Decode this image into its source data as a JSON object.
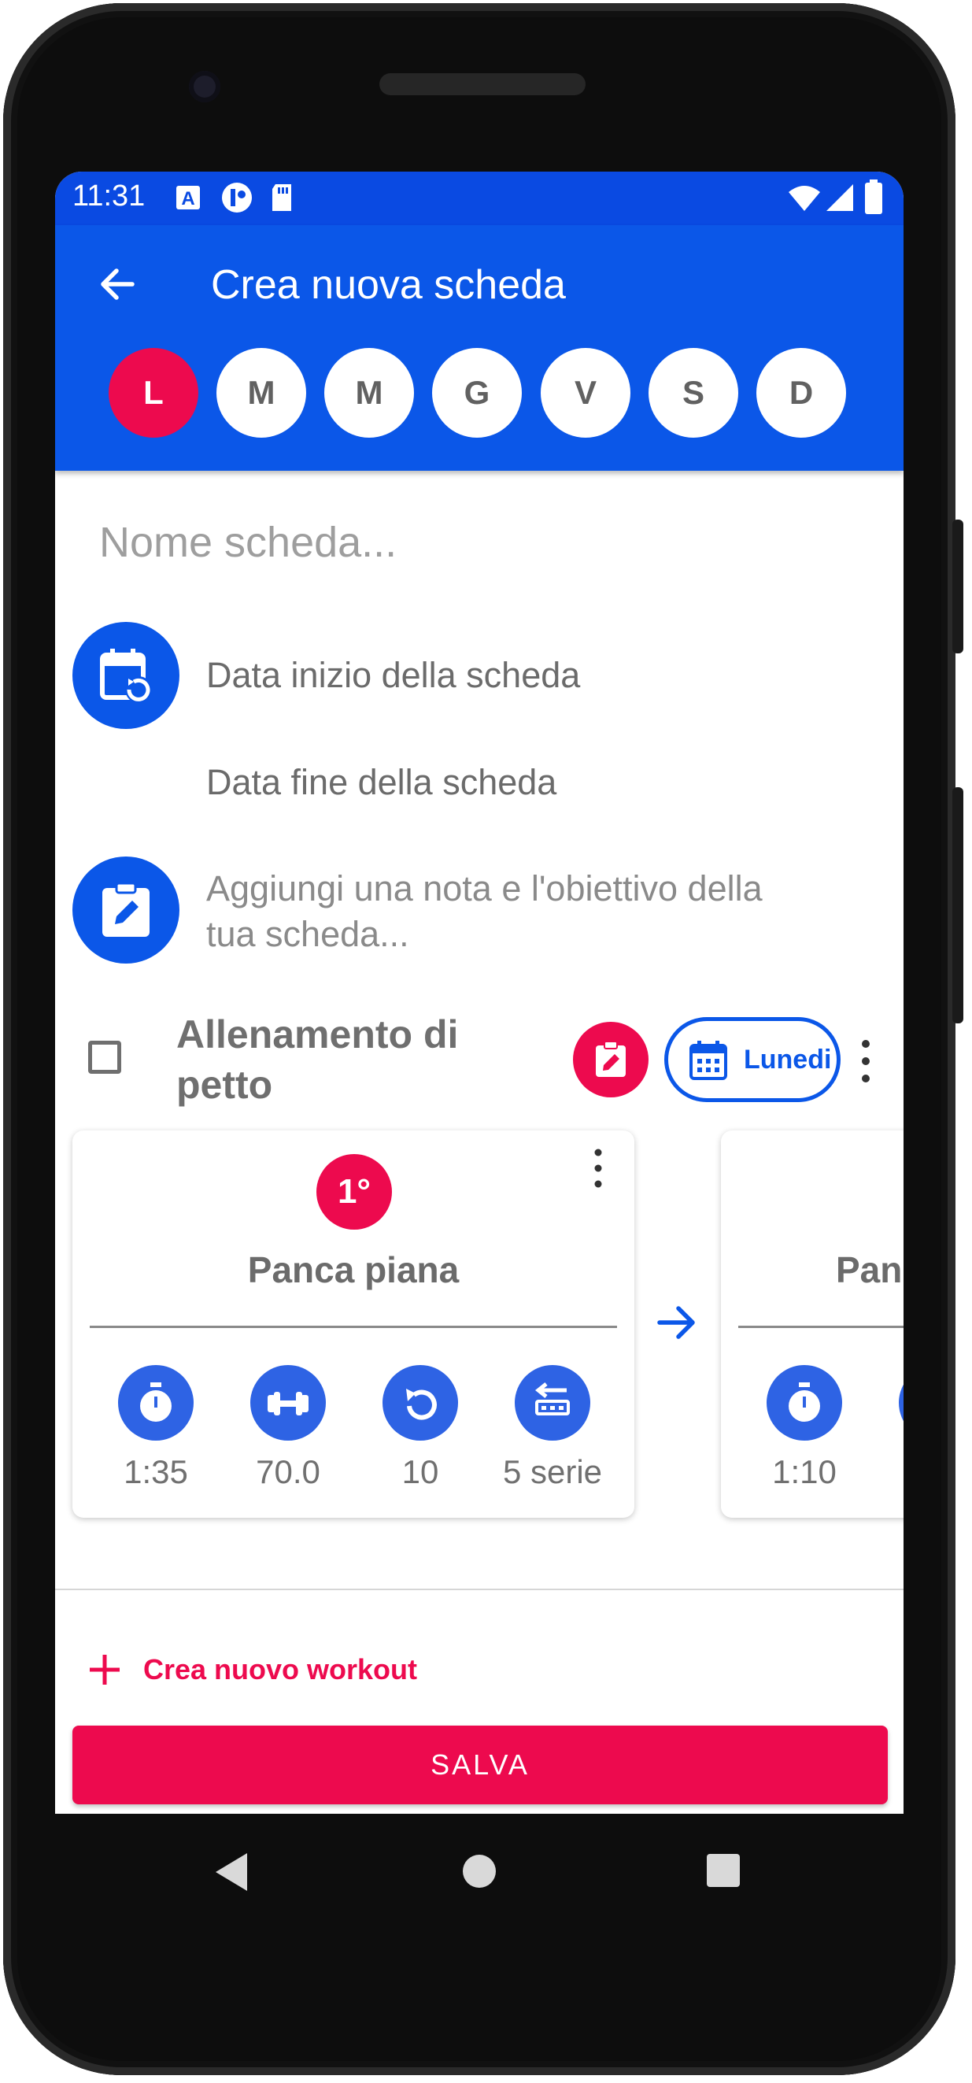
{
  "status": {
    "time": "11:31"
  },
  "header": {
    "title": "Crea nuova scheda"
  },
  "days": [
    "L",
    "M",
    "M",
    "G",
    "V",
    "S",
    "D"
  ],
  "form": {
    "name_placeholder": "Nome scheda...",
    "start_date_label": "Data inizio della scheda",
    "end_date_label": "Data fine della scheda",
    "note_placeholder_line1": "Aggiungi una nota e l'obiettivo della",
    "note_placeholder_line2": "tua scheda..."
  },
  "workout": {
    "title_line1": "Allenamento di",
    "title_line2": "petto",
    "day_chip": "Lunedi"
  },
  "exercises": [
    {
      "order": "1°",
      "name": "Panca piana",
      "stats": [
        "1:35",
        "70.0",
        "10",
        "5 serie"
      ]
    },
    {
      "name": "Pan",
      "stats": [
        "1:10"
      ]
    }
  ],
  "actions": {
    "new_workout": "Crea nuovo workout",
    "save": "SALVA"
  },
  "colors": {
    "primary": "#0b57e8",
    "accent": "#ed0a4e"
  }
}
